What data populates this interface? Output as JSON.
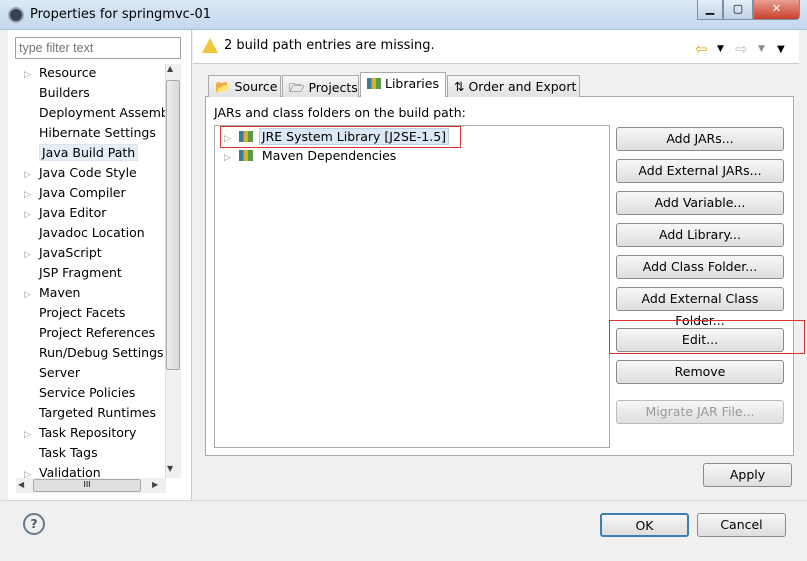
{
  "window": {
    "title": "Properties for springmvc-01"
  },
  "filter": {
    "placeholder": "type filter text"
  },
  "tree": [
    {
      "label": "Resource",
      "expandable": true
    },
    {
      "label": "Builders",
      "expandable": false
    },
    {
      "label": "Deployment Assembly",
      "expandable": false
    },
    {
      "label": "Hibernate Settings",
      "expandable": false
    },
    {
      "label": "Java Build Path",
      "expandable": false,
      "selected": true
    },
    {
      "label": "Java Code Style",
      "expandable": true
    },
    {
      "label": "Java Compiler",
      "expandable": true
    },
    {
      "label": "Java Editor",
      "expandable": true
    },
    {
      "label": "Javadoc Location",
      "expandable": false
    },
    {
      "label": "JavaScript",
      "expandable": true
    },
    {
      "label": "JSP Fragment",
      "expandable": false
    },
    {
      "label": "Maven",
      "expandable": true
    },
    {
      "label": "Project Facets",
      "expandable": false
    },
    {
      "label": "Project References",
      "expandable": false
    },
    {
      "label": "Run/Debug Settings",
      "expandable": false
    },
    {
      "label": "Server",
      "expandable": false
    },
    {
      "label": "Service Policies",
      "expandable": false
    },
    {
      "label": "Targeted Runtimes",
      "expandable": false
    },
    {
      "label": "Task Repository",
      "expandable": true
    },
    {
      "label": "Task Tags",
      "expandable": false
    },
    {
      "label": "Validation",
      "expandable": true
    }
  ],
  "hscroll_grip": "III",
  "warning": "2 build path entries are missing.",
  "tabs": [
    "Source",
    "Projects",
    "Libraries",
    "Order and Export"
  ],
  "active_tab": "Libraries",
  "panel_label": "JARs and class folders on the build path:",
  "libraries": [
    "JRE System Library [J2SE-1.5]",
    "Maven Dependencies"
  ],
  "buttons": [
    "Add JARs...",
    "Add External JARs...",
    "Add Variable...",
    "Add Library...",
    "Add Class Folder...",
    "Add External Class Folder..."
  ],
  "edit": "Edit...",
  "remove": "Remove",
  "migrate": "Migrate JAR File...",
  "apply": "Apply",
  "ok": "OK",
  "cancel": "Cancel",
  "help": "?",
  "highlight_color": "#e03030"
}
